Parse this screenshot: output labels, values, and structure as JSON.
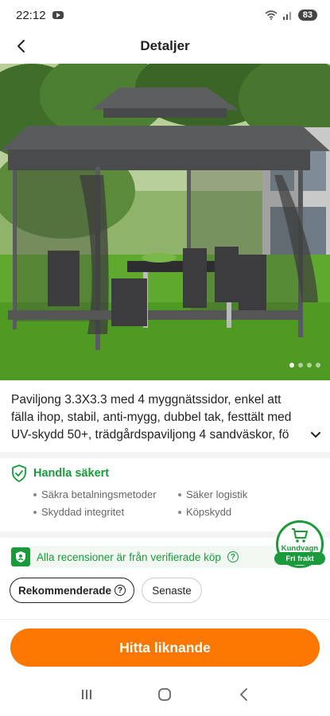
{
  "status_bar": {
    "time": "22:12",
    "battery": "83",
    "notification_icon": "youtube-icon",
    "signal_icons": [
      "wifi-icon",
      "signal-icon"
    ]
  },
  "header": {
    "title": "Detaljer",
    "back_icon": "back-arrow-icon"
  },
  "gallery": {
    "image_subject": "gazebo-photo",
    "total_images": 4,
    "active_index": 0
  },
  "product": {
    "title": "Paviljong 3.3X3.3 med 4 myggnätssidor, enkel att fälla ihop, stabil, anti-mygg, dubbel tak, festtält med UV-skydd 50+, trädgårdspaviljong 4 sandväskor, fö",
    "expand_icon": "chevron-down-icon"
  },
  "safe_shopping": {
    "title": "Handla säkert",
    "icon": "shield-check-icon",
    "items": [
      "Säkra betalningsmetoder",
      "Säker logistik",
      "Skyddad integritet",
      "Köpskydd"
    ]
  },
  "reviews": {
    "verified_text": "Alla recensioner är från verifierade köp",
    "filters": [
      {
        "label": "Rekommenderade",
        "active": true
      },
      {
        "label": "Senaste",
        "active": false
      }
    ]
  },
  "cart": {
    "label": "Kundvagn",
    "badge": "Fri frakt"
  },
  "cta": {
    "label": "Hitta liknande"
  },
  "colors": {
    "accent_orange": "#fb7701",
    "accent_green": "#1a9a3a"
  }
}
